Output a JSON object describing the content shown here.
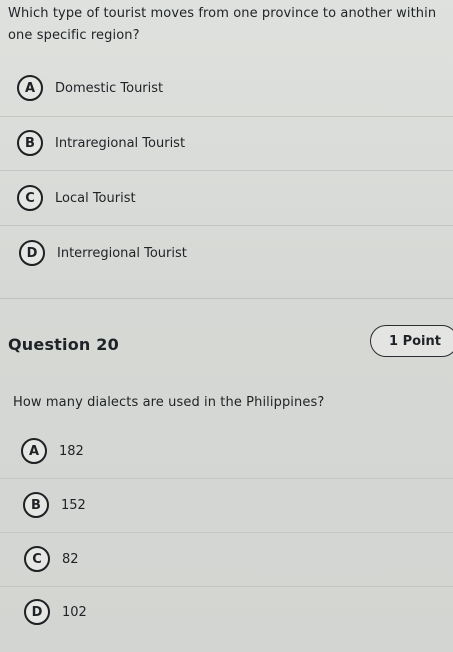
{
  "question19": {
    "text": "Which type of tourist moves from one province to another within one specific region?",
    "options": [
      {
        "letter": "A",
        "label": "Domestic Tourist"
      },
      {
        "letter": "B",
        "label": "Intraregional Tourist"
      },
      {
        "letter": "C",
        "label": "Local Tourist"
      },
      {
        "letter": "D",
        "label": "Interregional Tourist"
      }
    ]
  },
  "question20": {
    "title": "Question 20",
    "points": "1 Point",
    "text": "How many dialects are used in the Philippines?",
    "options": [
      {
        "letter": "A",
        "label": "182"
      },
      {
        "letter": "B",
        "label": "152"
      },
      {
        "letter": "C",
        "label": "82"
      },
      {
        "letter": "D",
        "label": "102"
      }
    ]
  }
}
